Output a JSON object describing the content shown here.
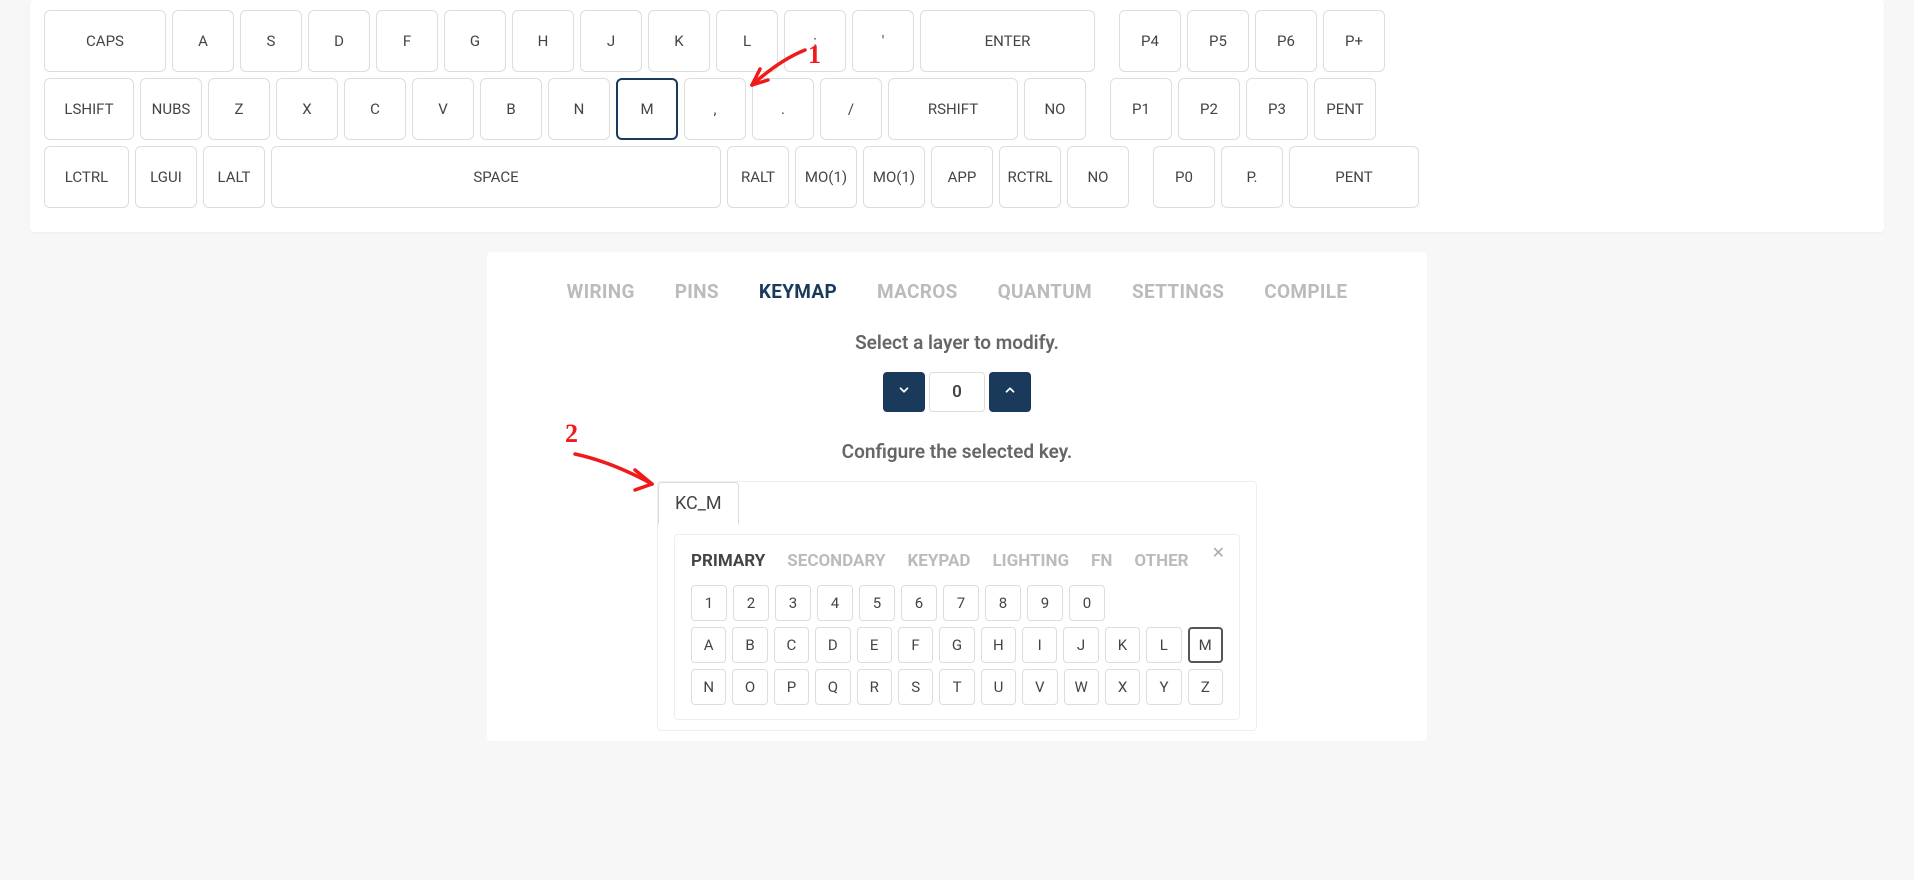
{
  "keyboard": {
    "row1": [
      "CAPS",
      "A",
      "S",
      "D",
      "F",
      "G",
      "H",
      "J",
      "K",
      "L",
      ";",
      "'",
      "ENTER",
      "P4",
      "P5",
      "P6",
      "P+"
    ],
    "row2": [
      "LSHIFT",
      "NUBS",
      "Z",
      "X",
      "C",
      "V",
      "B",
      "N",
      "M",
      ",",
      ".",
      "/",
      "RSHIFT",
      "NO",
      "P1",
      "P2",
      "P3",
      "PENT"
    ],
    "row3": [
      "LCTRL",
      "LGUI",
      "LALT",
      "SPACE",
      "RALT",
      "MO(1)",
      "MO(1)",
      "APP",
      "RCTRL",
      "NO",
      "P0",
      "P.",
      "PENT"
    ],
    "selected_key": "M"
  },
  "tabs": {
    "items": [
      "WIRING",
      "PINS",
      "KEYMAP",
      "MACROS",
      "QUANTUM",
      "SETTINGS",
      "COMPILE"
    ],
    "active": "KEYMAP"
  },
  "layer": {
    "prompt": "Select a layer to modify.",
    "value": "0"
  },
  "configure": {
    "prompt": "Configure the selected key.",
    "input_value": "KC_M"
  },
  "picker": {
    "tabs": [
      "PRIMARY",
      "SECONDARY",
      "KEYPAD",
      "LIGHTING",
      "FN",
      "OTHER"
    ],
    "active": "PRIMARY",
    "row_digits": [
      "1",
      "2",
      "3",
      "4",
      "5",
      "6",
      "7",
      "8",
      "9",
      "0"
    ],
    "row_alpha1": [
      "A",
      "B",
      "C",
      "D",
      "E",
      "F",
      "G",
      "H",
      "I",
      "J",
      "K",
      "L",
      "M"
    ],
    "row_alpha2": [
      "N",
      "O",
      "P",
      "Q",
      "R",
      "S",
      "T",
      "U",
      "V",
      "W",
      "X",
      "Y",
      "Z"
    ],
    "selected": "M"
  },
  "annotations": {
    "a1": "1",
    "a2": "2"
  }
}
